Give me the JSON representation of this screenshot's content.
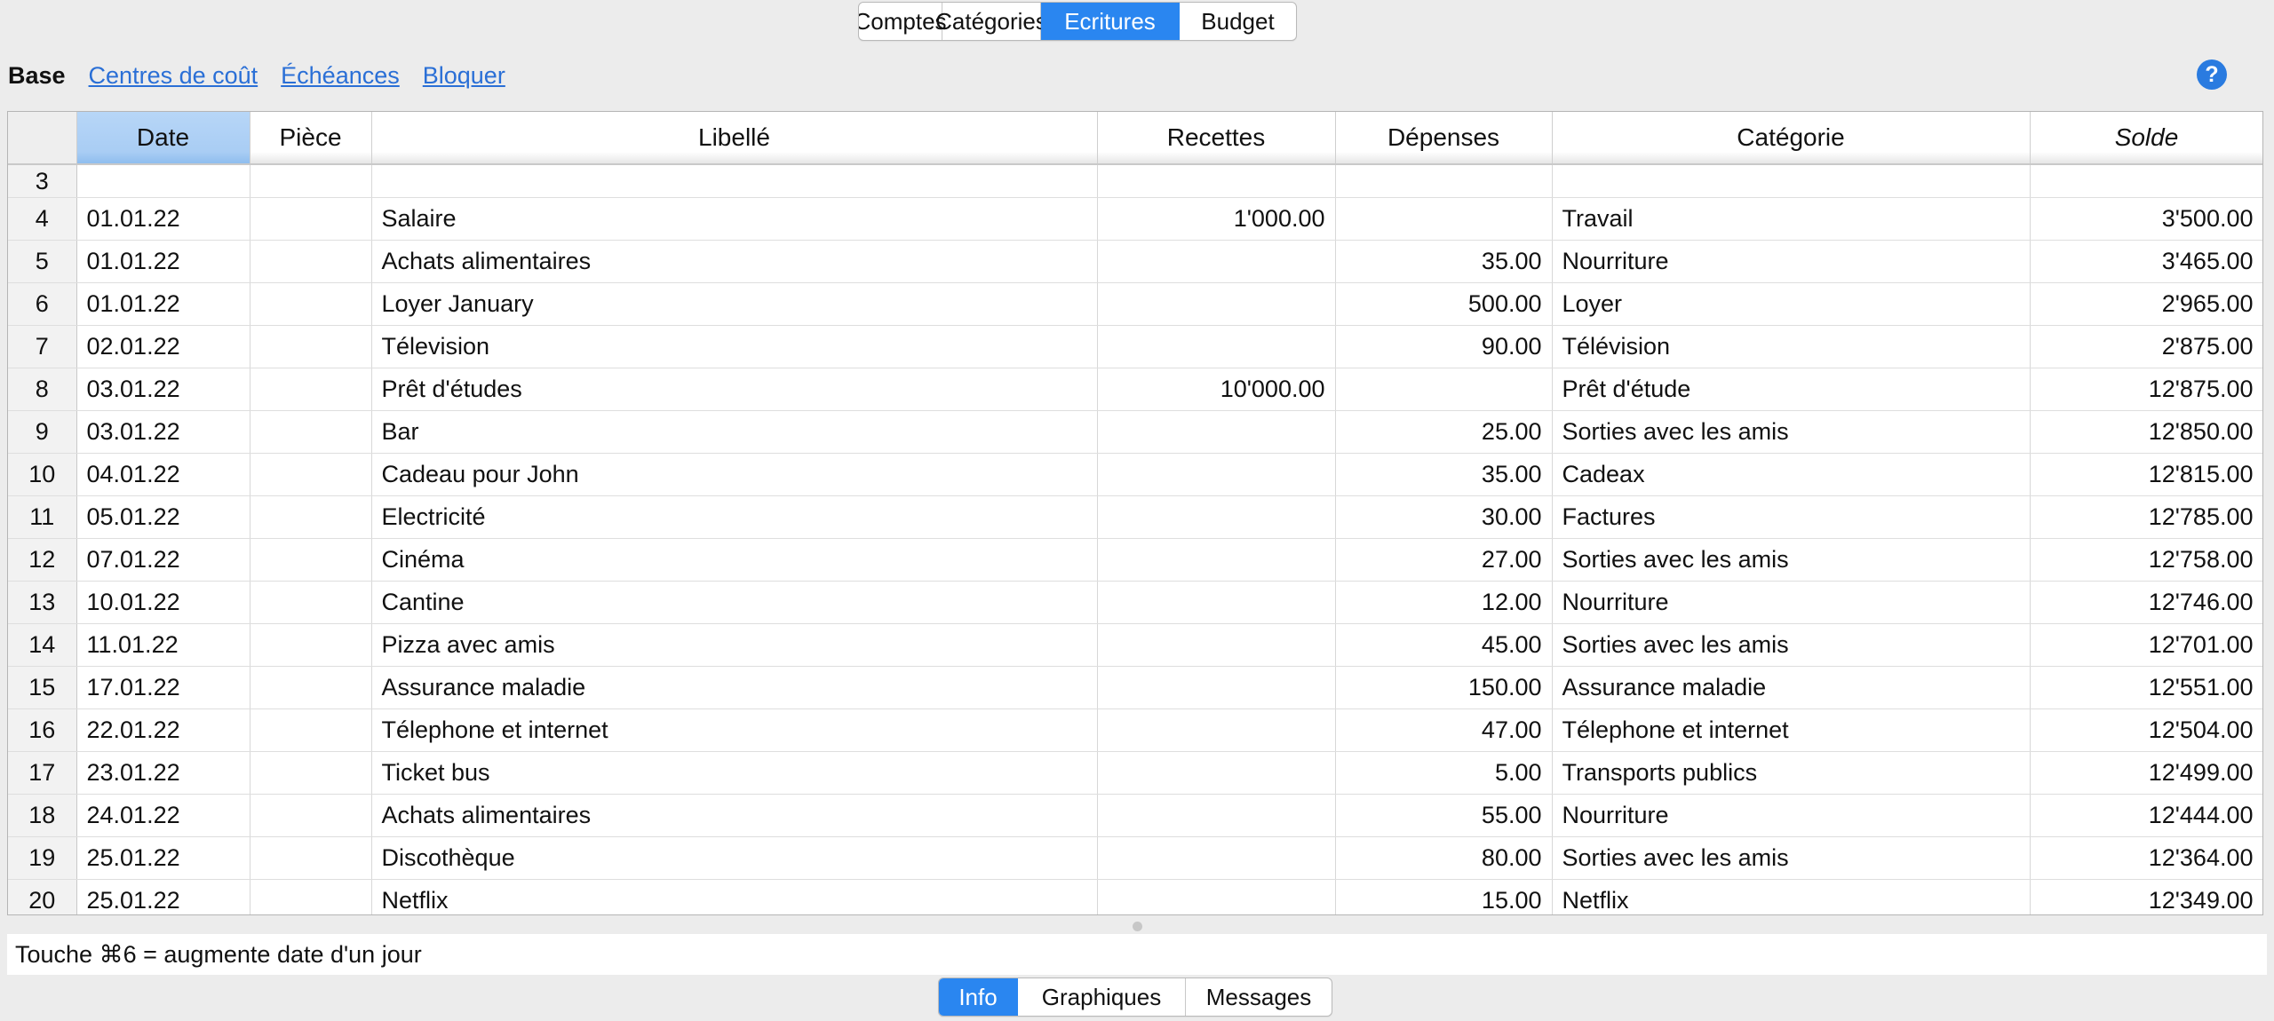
{
  "top_tabs": [
    {
      "label": "Comptes",
      "active": false
    },
    {
      "label": "Catégories",
      "active": false
    },
    {
      "label": "Ecritures",
      "active": true
    },
    {
      "label": "Budget",
      "active": false
    }
  ],
  "subtabs": {
    "current": "Base",
    "links": [
      "Centres de coût",
      "Échéances",
      "Bloquer"
    ]
  },
  "help_label": "?",
  "table": {
    "headers": [
      "Date",
      "Pièce",
      "Libellé",
      "Recettes",
      "Dépenses",
      "Catégorie",
      "Solde"
    ],
    "rows": [
      {
        "n": "3",
        "date": "",
        "piece": "",
        "libelle": "",
        "recettes": "",
        "depenses": "",
        "categorie": "",
        "solde": ""
      },
      {
        "n": "4",
        "date": "01.01.22",
        "piece": "",
        "libelle": "Salaire",
        "recettes": "1'000.00",
        "depenses": "",
        "categorie": "Travail",
        "solde": "3'500.00"
      },
      {
        "n": "5",
        "date": "01.01.22",
        "piece": "",
        "libelle": "Achats alimentaires",
        "recettes": "",
        "depenses": "35.00",
        "categorie": "Nourriture",
        "solde": "3'465.00"
      },
      {
        "n": "6",
        "date": "01.01.22",
        "piece": "",
        "libelle": "Loyer January",
        "recettes": "",
        "depenses": "500.00",
        "categorie": "Loyer",
        "solde": "2'965.00"
      },
      {
        "n": "7",
        "date": "02.01.22",
        "piece": "",
        "libelle": "Télevision",
        "recettes": "",
        "depenses": "90.00",
        "categorie": "Télévision",
        "solde": "2'875.00"
      },
      {
        "n": "8",
        "date": "03.01.22",
        "piece": "",
        "libelle": "Prêt d'études",
        "recettes": "10'000.00",
        "depenses": "",
        "categorie": "Prêt d'étude",
        "solde": "12'875.00"
      },
      {
        "n": "9",
        "date": "03.01.22",
        "piece": "",
        "libelle": "Bar",
        "recettes": "",
        "depenses": "25.00",
        "categorie": "Sorties avec les amis",
        "solde": "12'850.00"
      },
      {
        "n": "10",
        "date": "04.01.22",
        "piece": "",
        "libelle": "Cadeau pour John",
        "recettes": "",
        "depenses": "35.00",
        "categorie": "Cadeax",
        "solde": "12'815.00"
      },
      {
        "n": "11",
        "date": "05.01.22",
        "piece": "",
        "libelle": "Electricité",
        "recettes": "",
        "depenses": "30.00",
        "categorie": "Factures",
        "solde": "12'785.00"
      },
      {
        "n": "12",
        "date": "07.01.22",
        "piece": "",
        "libelle": "Cinéma",
        "recettes": "",
        "depenses": "27.00",
        "categorie": "Sorties avec les amis",
        "solde": "12'758.00"
      },
      {
        "n": "13",
        "date": "10.01.22",
        "piece": "",
        "libelle": "Cantine",
        "recettes": "",
        "depenses": "12.00",
        "categorie": "Nourriture",
        "solde": "12'746.00"
      },
      {
        "n": "14",
        "date": "11.01.22",
        "piece": "",
        "libelle": "Pizza avec amis",
        "recettes": "",
        "depenses": "45.00",
        "categorie": "Sorties avec les amis",
        "solde": "12'701.00"
      },
      {
        "n": "15",
        "date": "17.01.22",
        "piece": "",
        "libelle": "Assurance maladie",
        "recettes": "",
        "depenses": "150.00",
        "categorie": "Assurance maladie",
        "solde": "12'551.00"
      },
      {
        "n": "16",
        "date": "22.01.22",
        "piece": "",
        "libelle": "Télephone et internet",
        "recettes": "",
        "depenses": "47.00",
        "categorie": "Télephone et internet",
        "solde": "12'504.00"
      },
      {
        "n": "17",
        "date": "23.01.22",
        "piece": "",
        "libelle": "Ticket bus",
        "recettes": "",
        "depenses": "5.00",
        "categorie": "Transports publics",
        "solde": "12'499.00"
      },
      {
        "n": "18",
        "date": "24.01.22",
        "piece": "",
        "libelle": "Achats alimentaires",
        "recettes": "",
        "depenses": "55.00",
        "categorie": "Nourriture",
        "solde": "12'444.00"
      },
      {
        "n": "19",
        "date": "25.01.22",
        "piece": "",
        "libelle": "Discothèque",
        "recettes": "",
        "depenses": "80.00",
        "categorie": "Sorties avec les amis",
        "solde": "12'364.00"
      },
      {
        "n": "20",
        "date": "25.01.22",
        "piece": "",
        "libelle": "Netflix",
        "recettes": "",
        "depenses": "15.00",
        "categorie": "Netflix",
        "solde": "12'349.00"
      }
    ]
  },
  "info_text": "Touche ⌘6 = augmente date d'un jour",
  "bottom_tabs": [
    {
      "label": "Info",
      "active": true
    },
    {
      "label": "Graphiques",
      "active": false
    },
    {
      "label": "Messages",
      "active": false
    }
  ],
  "colors": {
    "accent": "#2a86f0",
    "link": "#2a6fd6",
    "selected_header": "#a9cdf4"
  }
}
